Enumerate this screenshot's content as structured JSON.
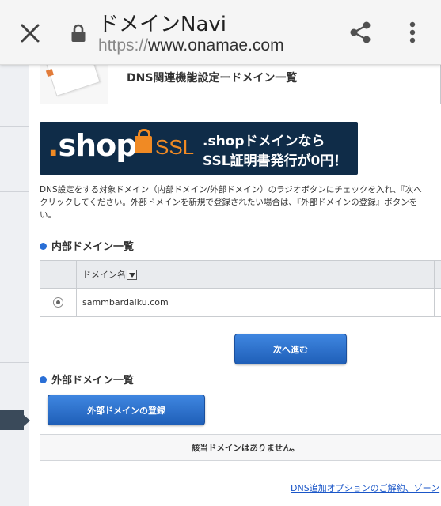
{
  "browser": {
    "title": "ドメインNavi",
    "url_scheme": "https://",
    "url_host": "www.onamae.com"
  },
  "header": {
    "title": "DNS関連機能設定ードメイン一覧"
  },
  "banner": {
    "logo_shop": "shop",
    "logo_ssl": "SSL",
    "promo_line1": ".shopドメインなら",
    "promo_line2": "SSL証明書発行が0円！"
  },
  "description": {
    "line1": "DNS設定をする対象ドメイン（内部ドメイン/外部ドメイン）のラジオボタンにチェックを入れ、『次へ",
    "line2": "クリックしてください。外部ドメインを新規で登録されたい場合は、『外部ドメインの登録』ボタンを",
    "line3": "い。"
  },
  "internal": {
    "heading": "内部ドメイン一覧",
    "column_domain": "ドメイン名",
    "rows": [
      {
        "domain": "sammbardaiku.com",
        "selected": true
      }
    ],
    "next_button": "次へ進む"
  },
  "external": {
    "heading": "外部ドメイン一覧",
    "register_button": "外部ドメインの登録",
    "empty_message": "該当ドメインはありません。"
  },
  "footer": {
    "link": "DNS追加オプションのご解約、ゾーン"
  },
  "colors": {
    "accent_blue": "#2a6fd6",
    "banner_bg": "#0f2c48",
    "banner_orange": "#f08a24"
  },
  "icons": [
    "close-icon",
    "lock-icon",
    "share-icon",
    "more-vert-icon",
    "sort-dropdown-icon"
  ]
}
